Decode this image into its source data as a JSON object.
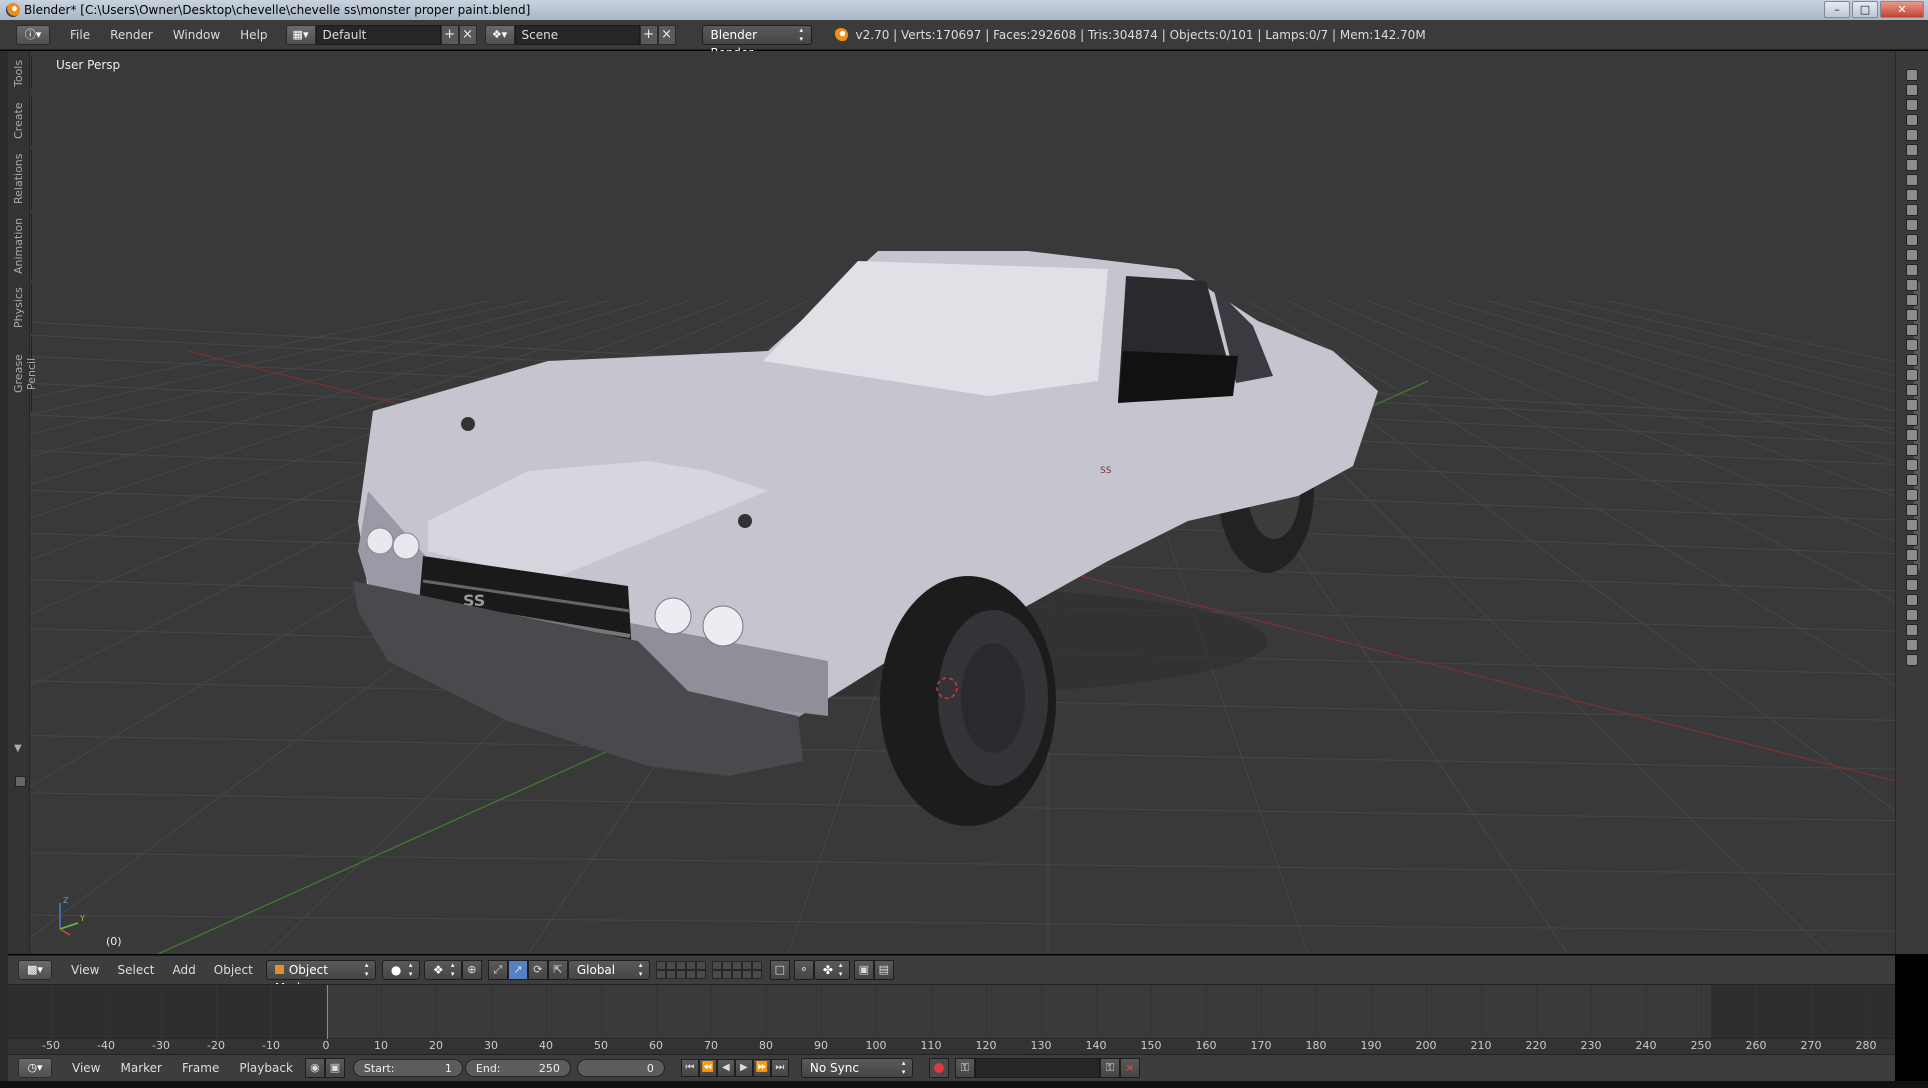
{
  "window": {
    "title": "Blender* [C:\\Users\\Owner\\Desktop\\chevelle\\chevelle ss\\monster proper paint.blend]",
    "controls": [
      "–",
      "□",
      "✕"
    ]
  },
  "info_header": {
    "editor_icon": "info-icon",
    "menus": [
      "File",
      "Render",
      "Window",
      "Help"
    ],
    "layout": {
      "icon": "screen-layout-icon",
      "name": "Default"
    },
    "scene": {
      "icon": "scene-icon",
      "name": "Scene"
    },
    "render_engine": "Blender Render",
    "stats": "v2.70 | Verts:170697 | Faces:292608 | Tris:304874 | Objects:0/101 | Lamps:0/7 | Mem:142.70M"
  },
  "viewport": {
    "view_label": "User Persp",
    "frame_label": "(0)",
    "tool_tabs": [
      "Tools",
      "Create",
      "Relations",
      "Animation",
      "Physics",
      "Grease Pencil"
    ],
    "axis_labels": {
      "z": "Z",
      "y": "Y"
    },
    "car_badge": "SS",
    "colors": {
      "background": "#393939",
      "grid": "#4a4a4a",
      "x_axis": "#8a2e2e",
      "y_axis": "#3f8a2e",
      "car_body": "#c9c9d2"
    }
  },
  "view3d_header": {
    "menus": [
      "View",
      "Select",
      "Add",
      "Object"
    ],
    "mode": "Object Mode",
    "orientation": "Global"
  },
  "timeline": {
    "ticks": [
      -50,
      -40,
      -30,
      -20,
      -10,
      0,
      10,
      20,
      30,
      40,
      50,
      60,
      70,
      80,
      90,
      100,
      110,
      120,
      130,
      140,
      150,
      160,
      170,
      180,
      190,
      200,
      210,
      220,
      230,
      240,
      250,
      260,
      270,
      280
    ],
    "current_frame_marker": 0,
    "range_end_marker": 250
  },
  "timeline_header": {
    "menus": [
      "View",
      "Marker",
      "Frame",
      "Playback"
    ],
    "start_label": "Start:",
    "start_value": "1",
    "end_label": "End:",
    "end_value": "250",
    "current_frame": "0",
    "sync": "No Sync"
  }
}
